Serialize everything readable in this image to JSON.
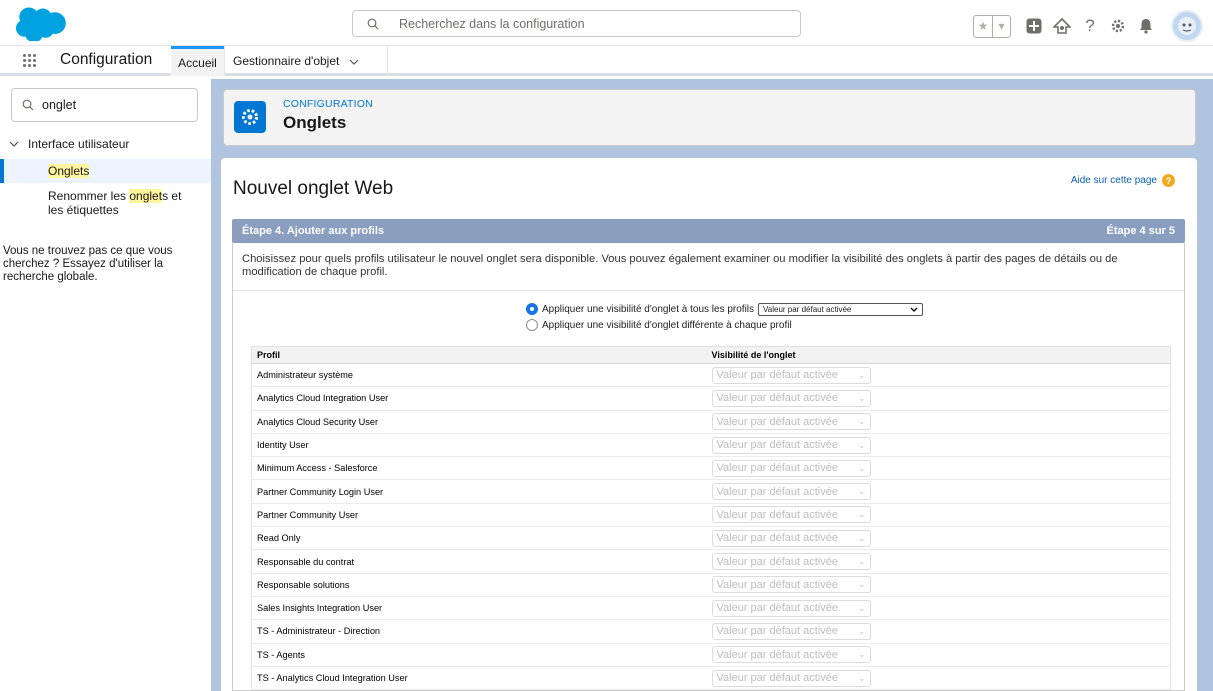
{
  "header": {
    "search_placeholder": "Recherchez dans la configuration",
    "icons": [
      "favorites-star-icon",
      "favorites-dropdown-icon",
      "add-icon",
      "trailhead-icon",
      "help-icon",
      "setup-gear-icon",
      "notifications-bell-icon",
      "avatar"
    ]
  },
  "nav": {
    "app_title": "Configuration",
    "tabs": [
      "Accueil",
      "Gestionnaire d'objet"
    ]
  },
  "sidebar": {
    "quickfind_value": "onglet",
    "section": "Interface utilisateur",
    "items": [
      {
        "label": "Onglets"
      },
      {
        "label_before": "Renommer les ",
        "label_hl": "onglet",
        "label_after": "s et les étiquettes"
      }
    ],
    "help_text": "Vous ne trouvez pas ce que vous cherchez ? Essayez d'utiliser la recherche globale."
  },
  "page_header": {
    "breadcrumb": "CONFIGURATION",
    "title": "Onglets"
  },
  "wizard": {
    "title": "Nouvel onglet Web",
    "help_link": "Aide sur cette page",
    "step_title": "Étape 4. Ajouter aux profils",
    "step_counter": "Étape 4 sur 5",
    "description": "Choisissez pour quels profils utilisateur le nouvel onglet sera disponible. Vous pouvez également examiner ou modifier la visibilité des onglets à partir des pages de détails ou de modification de chaque profil.",
    "radio_all_label": "Appliquer une visibilité d'onglet à tous les profils",
    "radio_all_value": "Valeur par défaut activée",
    "radio_each_label": "Appliquer une visibilité d'onglet différente à chaque profil",
    "table": {
      "col_profile": "Profil",
      "col_visibility": "Visibilité de l'onglet",
      "default_value": "Valeur par défaut activée",
      "rows": [
        "Administrateur système",
        "Analytics Cloud Integration User",
        "Analytics Cloud Security User",
        "Identity User",
        "Minimum Access - Salesforce",
        "Partner Community Login User",
        "Partner Community User",
        "Read Only",
        "Responsable du contrat",
        "Responsable solutions",
        "Sales Insights Integration User",
        "TS - Administrateur - Direction",
        "TS - Agents",
        "TS - Analytics Cloud Integration User"
      ]
    }
  },
  "colors": {
    "brand_blue": "#0176d3",
    "step_bar": "#8a9ec0",
    "main_bg": "#b0c4df",
    "highlight": "#fff59d",
    "help_orange": "#f2a922"
  }
}
